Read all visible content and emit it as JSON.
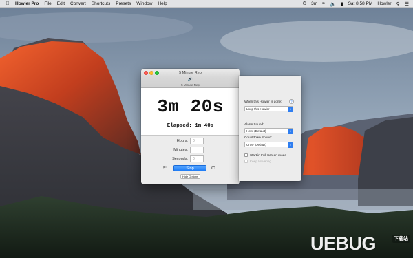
{
  "menubar": {
    "app_name": "Howler Pro",
    "items": [
      "File",
      "Edit",
      "Convert",
      "Shortcuts",
      "Presets",
      "Window",
      "Help"
    ],
    "status": {
      "timer": "3m",
      "clock": "Sat 8:58 PM",
      "app_menu": "Howler"
    }
  },
  "main_window": {
    "title": "5 Minute Rep",
    "subtitle": "5 Minute Rep",
    "countdown": "3m 20s",
    "elapsed": "Elapsed: 1m 40s",
    "fields": {
      "hours": {
        "label": "Hours:",
        "placeholder": "0"
      },
      "minutes": {
        "label": "Minutes:",
        "placeholder": ""
      },
      "seconds": {
        "label": "Seconds:",
        "placeholder": "0"
      }
    },
    "stop_label": "Stop",
    "hide_options_label": "Hide Options"
  },
  "options": {
    "when_done_label": "When this Howler is done:",
    "when_done_value": "Loop this Howler",
    "alarm_sound_label": "Alarm Sound:",
    "alarm_sound_value": "Howl (Default)",
    "countdown_sound_label": "Countdown Sound:",
    "countdown_sound_value": "Crow (Default)",
    "start_fullscreen_label": "Start in Full Screen mode",
    "keep_hovering_label": "Keep Hovering",
    "help_glyph": "?"
  },
  "watermark": {
    "text": "UEBUG",
    "badge": "下载站"
  },
  "colors": {
    "accent": "#1e7cf6",
    "close": "#ff5f57",
    "minimize": "#febc2e",
    "zoom": "#28c840"
  }
}
